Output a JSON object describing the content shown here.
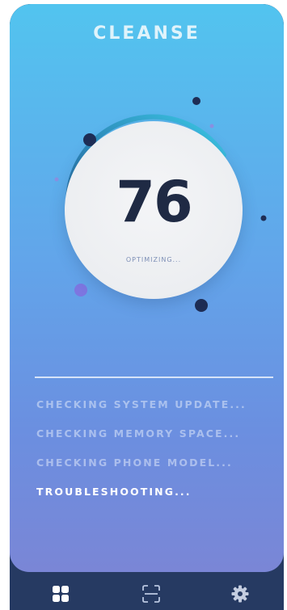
{
  "app": {
    "title": "CLEANSE"
  },
  "gauge": {
    "score": "76",
    "status": "OPTIMIZING...",
    "progress_fraction": 0.76,
    "colors": {
      "arc_start": "#1f5a8a",
      "arc_end": "#36c6e6",
      "track": "#2b9fd4"
    }
  },
  "checks": {
    "items": [
      {
        "label": "CHECKING SYSTEM UPDATE...",
        "active": false
      },
      {
        "label": "CHECKING MEMORY SPACE...",
        "active": false
      },
      {
        "label": "CHECKING PHONE MODEL...",
        "active": false
      },
      {
        "label": "TROUBLESHOOTING...",
        "active": true
      }
    ]
  },
  "navbar": {
    "items": [
      {
        "icon": "dashboard-icon",
        "selected": true
      },
      {
        "icon": "scan-icon",
        "selected": false
      },
      {
        "icon": "settings-icon",
        "selected": false
      }
    ]
  },
  "colors": {
    "gradient_top": "#52c4ef",
    "gradient_bottom": "#7a86d6",
    "navbar_bg": "#263a62",
    "text_dark": "#1f2a44"
  }
}
